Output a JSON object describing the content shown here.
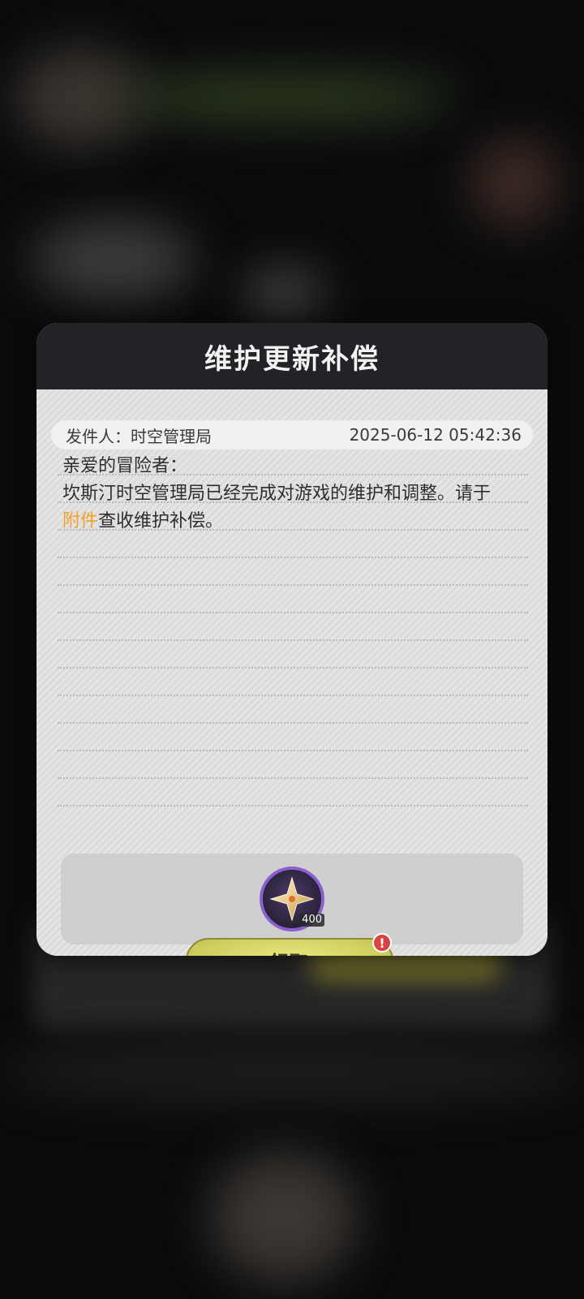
{
  "mail": {
    "title": "维护更新补偿",
    "sender_label": "发件人：",
    "sender_name": "时空管理局",
    "timestamp": "2025-06-12 05:42:36",
    "greeting": "亲爱的冒险者：",
    "body_line1": "坎斯汀时空管理局已经完成对游戏的维护和调整。请于",
    "body_highlight": "附件",
    "body_line2_rest": "查收维护补偿。"
  },
  "attachment": {
    "icon": "star-crystal-icon",
    "count": "400",
    "ring_color": "#8a5fd0"
  },
  "actions": {
    "claim_label": "领取",
    "alert_mark": "!"
  },
  "colors": {
    "header_bg": "#222326",
    "highlight": "#f0a227",
    "claim_button": "#cfcf60",
    "alert": "#d64541"
  }
}
